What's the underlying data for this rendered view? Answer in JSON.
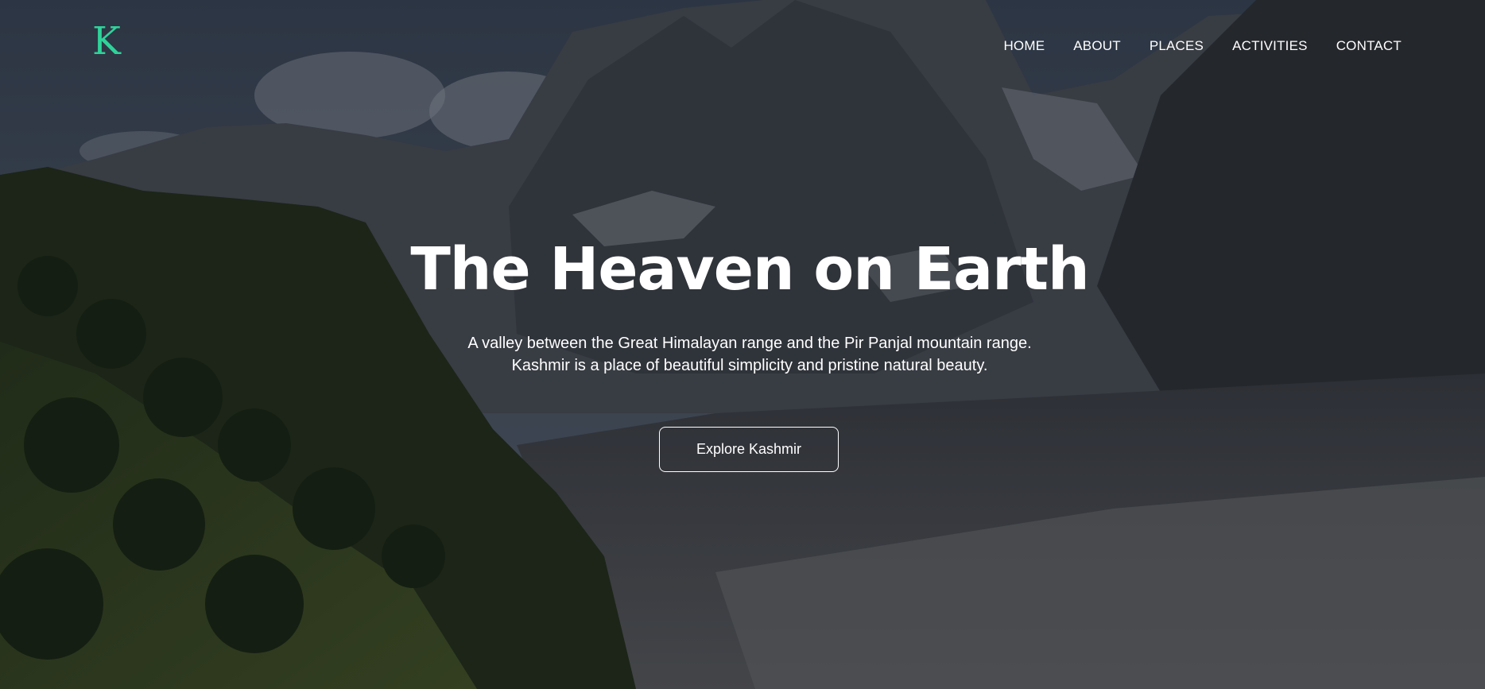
{
  "brand": {
    "logo_text": "K",
    "accent_color": "#2fd39a"
  },
  "nav": {
    "items": [
      {
        "label": "HOME"
      },
      {
        "label": "ABOUT"
      },
      {
        "label": "PLACES"
      },
      {
        "label": "ACTIVITIES"
      },
      {
        "label": "CONTACT"
      }
    ]
  },
  "hero": {
    "title": "The Heaven on Earth",
    "subtitle_line1": "A valley between the Great Himalayan range and the Pir Panjal mountain range.",
    "subtitle_line2": "Kashmir is a place of beautiful simplicity and pristine natural beauty.",
    "cta_label": "Explore Kashmir",
    "background": "mountain-valley-photo"
  }
}
